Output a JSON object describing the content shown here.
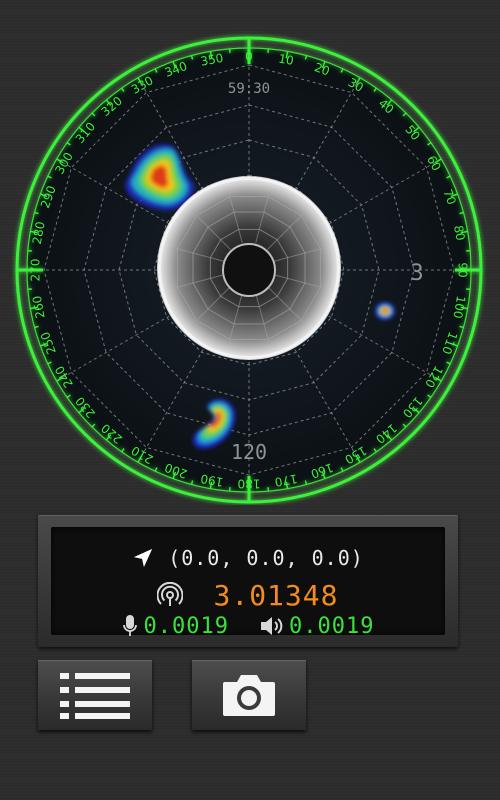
{
  "radar": {
    "degree_labels": [
      "0",
      "10",
      "20",
      "30",
      "40",
      "50",
      "60",
      "70",
      "80",
      "90",
      "100",
      "110",
      "120",
      "130",
      "140",
      "150",
      "160",
      "170",
      "180",
      "190",
      "200",
      "210",
      "220",
      "230",
      "240",
      "250",
      "260",
      "270",
      "280",
      "290",
      "300",
      "310",
      "320",
      "330",
      "340",
      "350"
    ],
    "ring_labels": {
      "top": "59:30",
      "right": "3",
      "bottom": "120"
    },
    "blobs": [
      {
        "name": "target-blob-large",
        "bearing_deg": 306,
        "strength": 1.0
      },
      {
        "name": "target-blob-small",
        "bearing_deg": 101,
        "strength": 0.7
      },
      {
        "name": "target-blob-lower",
        "bearing_deg": 198,
        "strength": 0.95
      }
    ],
    "colors": {
      "dial_green": "#3df03a",
      "grid": "#9aa0a4",
      "background": "#0f1416"
    }
  },
  "readout": {
    "coordinates": "(0.0, 0.0, 0.0)",
    "level": "3.01348",
    "mic_level": "0.0019",
    "speaker_level": "0.0019",
    "icons": [
      "location-arrow-icon",
      "signal-icon",
      "microphone-icon",
      "speaker-icon"
    ],
    "colors": {
      "level": "#f28c1a",
      "audio": "#39e23a",
      "coordinates": "#eaeaea"
    }
  },
  "buttons": {
    "menu": {
      "icon": "list-icon"
    },
    "camera": {
      "icon": "camera-icon"
    }
  }
}
